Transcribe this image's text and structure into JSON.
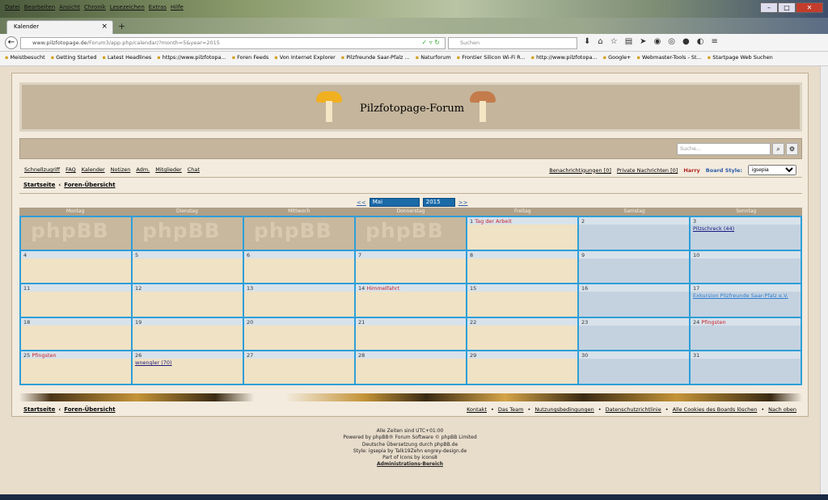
{
  "browser": {
    "menu": [
      "Datei",
      "Bearbeiten",
      "Ansicht",
      "Chronik",
      "Lesezeichen",
      "Extras",
      "Hilfe"
    ],
    "tab_title": "Kalender",
    "url_host": "www.pilzfotopage.de",
    "url_path": "/Forum3/app.php/calendar/?month=5&year=2015",
    "search_placeholder": "Suchen",
    "bookmarks": [
      "Meistbesucht",
      "Getting Started",
      "Latest Headlines",
      "https://www.pilzfotopa...",
      "Foren Feeds",
      "Von Internet Explorer",
      "Pilzfreunde Saar-Pfalz ...",
      "Naturforum",
      "Frontier Silicon Wi-Fi R...",
      "http://www.pilzfotopa...",
      "Google+",
      "Webmaster-Tools - St...",
      "Startpage Web Suchen"
    ]
  },
  "site": {
    "title": "Pilzfotopage-Forum",
    "search_placeholder": "Suche...",
    "quicklinks": [
      "Schnellzugriff",
      "FAQ",
      "Kalender",
      "Notizen",
      "Adm.",
      "Mitglieder",
      "Chat"
    ],
    "notifications": "Benachrichtigungen [0]",
    "private_messages": "Private Nachrichten [0]",
    "username": "Harry",
    "board_style_label": "Board Style:",
    "board_style_value": "igsepia",
    "breadcrumb": {
      "home": "Startseite",
      "sep": "‹",
      "index": "Foren-Übersicht"
    }
  },
  "calendar": {
    "prev": "<<",
    "next": ">>",
    "month": "Mai",
    "year": "2015",
    "weekdays": [
      "Montag",
      "Dienstag",
      "Mittwoch",
      "Donnerstag",
      "Freitag",
      "Samstag",
      "Sonntag"
    ],
    "blank_logo": "phpBB",
    "cells": [
      {
        "day": "",
        "blank": true
      },
      {
        "day": "",
        "blank": true
      },
      {
        "day": "",
        "blank": true
      },
      {
        "day": "",
        "blank": true
      },
      {
        "day": "1",
        "holiday": "Tag der Arbeit"
      },
      {
        "day": "2"
      },
      {
        "day": "3",
        "event": "Pilzschreck (44)"
      },
      {
        "day": "4"
      },
      {
        "day": "5"
      },
      {
        "day": "6"
      },
      {
        "day": "7"
      },
      {
        "day": "8"
      },
      {
        "day": "9"
      },
      {
        "day": "10"
      },
      {
        "day": "11"
      },
      {
        "day": "12"
      },
      {
        "day": "13"
      },
      {
        "day": "14",
        "holiday": "Himmelfahrt"
      },
      {
        "day": "15"
      },
      {
        "day": "16"
      },
      {
        "day": "17",
        "event": "Exkursion Pilzfreunde Saar-Pfalz e.V.",
        "event_blue": true
      },
      {
        "day": "18"
      },
      {
        "day": "19"
      },
      {
        "day": "20"
      },
      {
        "day": "21"
      },
      {
        "day": "22"
      },
      {
        "day": "23"
      },
      {
        "day": "24",
        "holiday": "Pfingsten"
      },
      {
        "day": "25",
        "holiday": "Pfingsten"
      },
      {
        "day": "26",
        "event": "wnengler (70)"
      },
      {
        "day": "27"
      },
      {
        "day": "28"
      },
      {
        "day": "29"
      },
      {
        "day": "30"
      },
      {
        "day": "31"
      }
    ]
  },
  "footer_links": [
    "Kontakt",
    "Das Team",
    "Nutzungsbedingungen",
    "Datenschutzrichtlinie",
    "Alle Cookies des Boards löschen",
    "Nach oben"
  ],
  "footer": {
    "timezone": "Alle Zeiten sind UTC+01:00",
    "powered": "Powered by phpBB® Forum Software © phpBB Limited",
    "translation": "Deutsche Übersetzung durch phpBB.de",
    "style": "Style: igsepia by Talk19Zehn engrey-design.de",
    "icons": "Part of Icons by icons8",
    "admin": "Administrations-Bereich"
  }
}
